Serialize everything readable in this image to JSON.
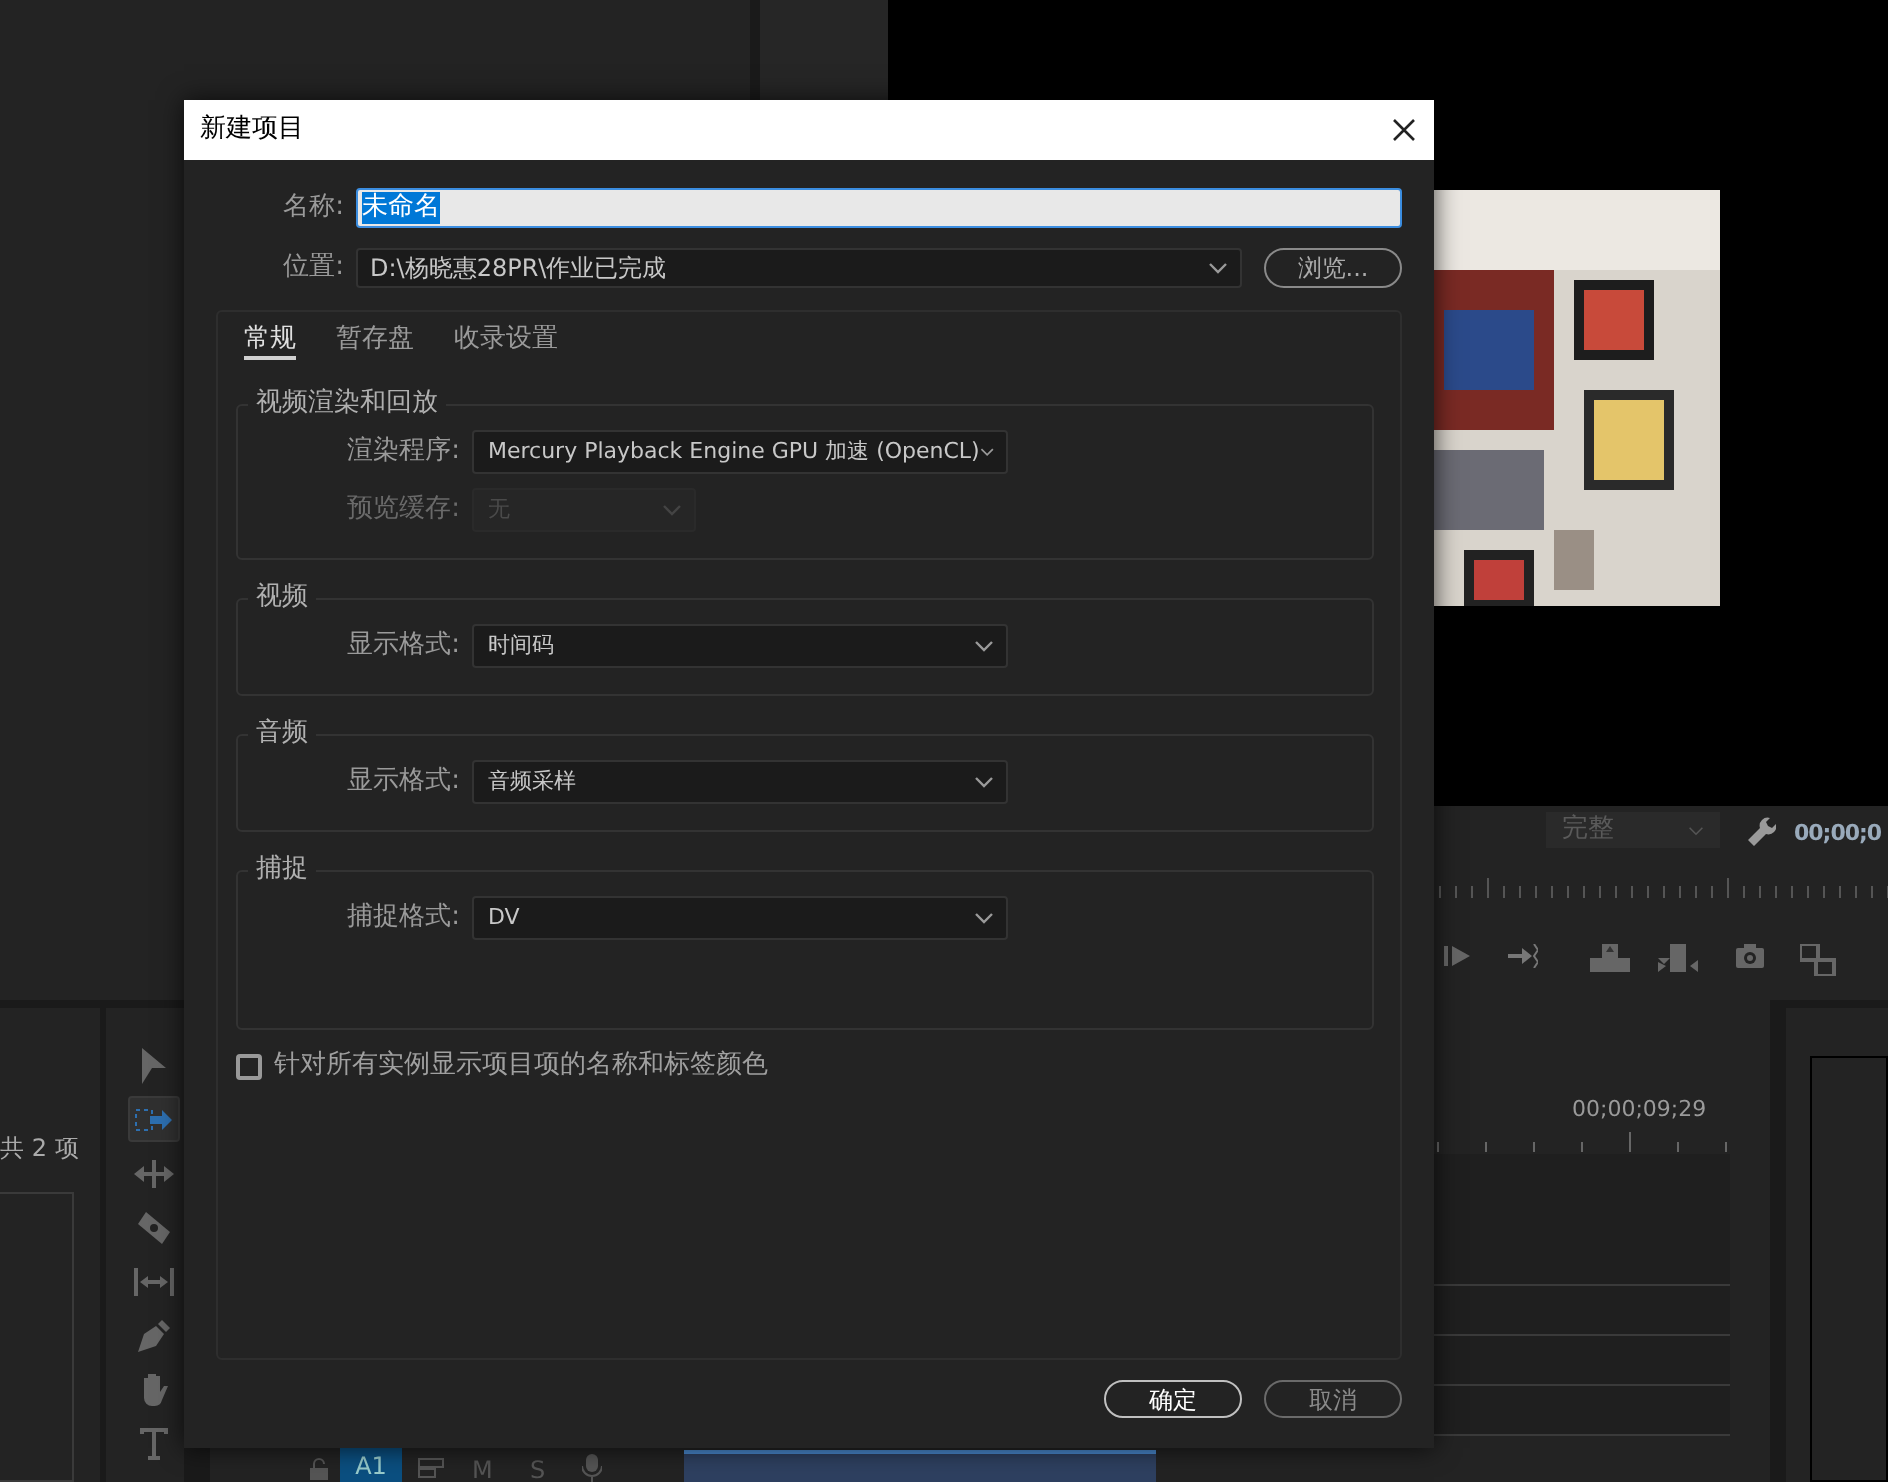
{
  "project_panel": {
    "item_count": "共 2 项"
  },
  "program_monitor": {
    "quality": "完整",
    "timecode": "00;00;0"
  },
  "tools": [
    {
      "kind": "selection",
      "selected": false
    },
    {
      "kind": "track-select",
      "selected": true
    },
    {
      "kind": "ripple",
      "selected": false
    },
    {
      "kind": "razor",
      "selected": false
    },
    {
      "kind": "slip",
      "selected": false
    },
    {
      "kind": "pen",
      "selected": false
    },
    {
      "kind": "hand",
      "selected": false
    },
    {
      "kind": "type",
      "selected": false
    }
  ],
  "timeline": {
    "timecode": "00;00;09;29",
    "track": {
      "label": "A1",
      "targeted": true,
      "mute": "M",
      "solo": "S"
    }
  },
  "dialog": {
    "title": "新建项目",
    "name_field": {
      "label": "名称:",
      "value": "未命名",
      "text_selected": true
    },
    "location_field": {
      "label": "位置:",
      "value": "D:\\杨晓惠28PR\\作业已完成"
    },
    "browse_button": "浏览...",
    "tabs": [
      {
        "label": "常规",
        "selected": true
      },
      {
        "label": "暂存盘",
        "selected": false
      },
      {
        "label": "收录设置",
        "selected": false
      }
    ],
    "groups": [
      {
        "title": "视频渲染和回放",
        "rows": [
          {
            "label": "渲染程序:",
            "value": "Mercury Playback Engine GPU 加速 (OpenCL)",
            "disabled": false
          },
          {
            "label": "预览缓存:",
            "value": "无",
            "disabled": true
          }
        ]
      },
      {
        "title": "视频",
        "rows": [
          {
            "label": "显示格式:",
            "value": "时间码",
            "disabled": false
          }
        ]
      },
      {
        "title": "音频",
        "rows": [
          {
            "label": "显示格式:",
            "value": "音频采样",
            "disabled": false
          }
        ]
      },
      {
        "title": "捕捉",
        "rows": [
          {
            "label": "捕捉格式:",
            "value": "DV",
            "disabled": false
          }
        ]
      }
    ],
    "checkbox": {
      "label": "针对所有实例显示项目项的名称和标签颜色",
      "checked": false
    },
    "buttons": [
      {
        "label": "确定",
        "kind": "primary"
      },
      {
        "label": "取消",
        "kind": "secondary"
      }
    ]
  }
}
